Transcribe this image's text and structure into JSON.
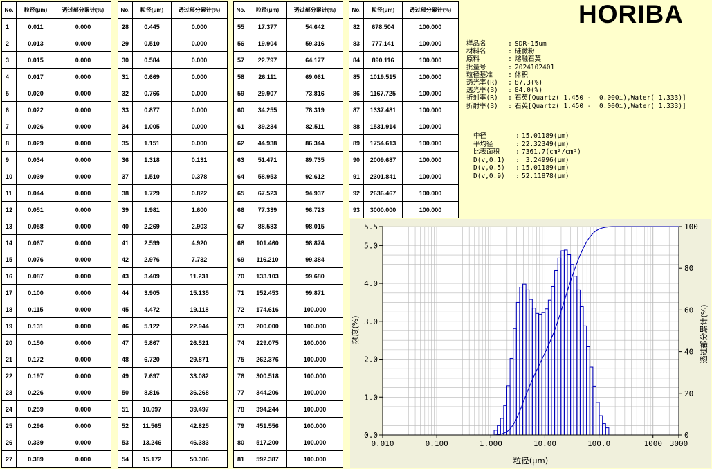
{
  "table": {
    "headers": [
      "No.",
      "粒径(μm)",
      "透过部分累计(%)"
    ],
    "columns": [
      {
        "rows": [
          [
            "1",
            "0.011",
            "0.000"
          ],
          [
            "2",
            "0.013",
            "0.000"
          ],
          [
            "3",
            "0.015",
            "0.000"
          ],
          [
            "4",
            "0.017",
            "0.000"
          ],
          [
            "5",
            "0.020",
            "0.000"
          ],
          [
            "6",
            "0.022",
            "0.000"
          ],
          [
            "7",
            "0.026",
            "0.000"
          ],
          [
            "8",
            "0.029",
            "0.000"
          ],
          [
            "9",
            "0.034",
            "0.000"
          ],
          [
            "10",
            "0.039",
            "0.000"
          ],
          [
            "11",
            "0.044",
            "0.000"
          ],
          [
            "12",
            "0.051",
            "0.000"
          ],
          [
            "13",
            "0.058",
            "0.000"
          ],
          [
            "14",
            "0.067",
            "0.000"
          ],
          [
            "15",
            "0.076",
            "0.000"
          ],
          [
            "16",
            "0.087",
            "0.000"
          ],
          [
            "17",
            "0.100",
            "0.000"
          ],
          [
            "18",
            "0.115",
            "0.000"
          ],
          [
            "19",
            "0.131",
            "0.000"
          ],
          [
            "20",
            "0.150",
            "0.000"
          ],
          [
            "21",
            "0.172",
            "0.000"
          ],
          [
            "22",
            "0.197",
            "0.000"
          ],
          [
            "23",
            "0.226",
            "0.000"
          ],
          [
            "24",
            "0.259",
            "0.000"
          ],
          [
            "25",
            "0.296",
            "0.000"
          ],
          [
            "26",
            "0.339",
            "0.000"
          ],
          [
            "27",
            "0.389",
            "0.000"
          ]
        ]
      },
      {
        "rows": [
          [
            "28",
            "0.445",
            "0.000"
          ],
          [
            "29",
            "0.510",
            "0.000"
          ],
          [
            "30",
            "0.584",
            "0.000"
          ],
          [
            "31",
            "0.669",
            "0.000"
          ],
          [
            "32",
            "0.766",
            "0.000"
          ],
          [
            "33",
            "0.877",
            "0.000"
          ],
          [
            "34",
            "1.005",
            "0.000"
          ],
          [
            "35",
            "1.151",
            "0.000"
          ],
          [
            "36",
            "1.318",
            "0.131"
          ],
          [
            "37",
            "1.510",
            "0.378"
          ],
          [
            "38",
            "1.729",
            "0.822"
          ],
          [
            "39",
            "1.981",
            "1.600"
          ],
          [
            "40",
            "2.269",
            "2.903"
          ],
          [
            "41",
            "2.599",
            "4.920"
          ],
          [
            "42",
            "2.976",
            "7.732"
          ],
          [
            "43",
            "3.409",
            "11.231"
          ],
          [
            "44",
            "3.905",
            "15.135"
          ],
          [
            "45",
            "4.472",
            "19.118"
          ],
          [
            "46",
            "5.122",
            "22.944"
          ],
          [
            "47",
            "5.867",
            "26.521"
          ],
          [
            "48",
            "6.720",
            "29.871"
          ],
          [
            "49",
            "7.697",
            "33.082"
          ],
          [
            "50",
            "8.816",
            "36.268"
          ],
          [
            "51",
            "10.097",
            "39.497"
          ],
          [
            "52",
            "11.565",
            "42.825"
          ],
          [
            "53",
            "13.246",
            "46.383"
          ],
          [
            "54",
            "15.172",
            "50.306"
          ]
        ]
      },
      {
        "rows": [
          [
            "55",
            "17.377",
            "54.642"
          ],
          [
            "56",
            "19.904",
            "59.316"
          ],
          [
            "57",
            "22.797",
            "64.177"
          ],
          [
            "58",
            "26.111",
            "69.061"
          ],
          [
            "59",
            "29.907",
            "73.816"
          ],
          [
            "60",
            "34.255",
            "78.319"
          ],
          [
            "61",
            "39.234",
            "82.511"
          ],
          [
            "62",
            "44.938",
            "86.344"
          ],
          [
            "63",
            "51.471",
            "89.735"
          ],
          [
            "64",
            "58.953",
            "92.612"
          ],
          [
            "65",
            "67.523",
            "94.937"
          ],
          [
            "66",
            "77.339",
            "96.723"
          ],
          [
            "67",
            "88.583",
            "98.015"
          ],
          [
            "68",
            "101.460",
            "98.874"
          ],
          [
            "69",
            "116.210",
            "99.384"
          ],
          [
            "70",
            "133.103",
            "99.680"
          ],
          [
            "71",
            "152.453",
            "99.871"
          ],
          [
            "72",
            "174.616",
            "100.000"
          ],
          [
            "73",
            "200.000",
            "100.000"
          ],
          [
            "74",
            "229.075",
            "100.000"
          ],
          [
            "75",
            "262.376",
            "100.000"
          ],
          [
            "76",
            "300.518",
            "100.000"
          ],
          [
            "77",
            "344.206",
            "100.000"
          ],
          [
            "78",
            "394.244",
            "100.000"
          ],
          [
            "79",
            "451.556",
            "100.000"
          ],
          [
            "80",
            "517.200",
            "100.000"
          ],
          [
            "81",
            "592.387",
            "100.000"
          ]
        ]
      },
      {
        "rows": [
          [
            "82",
            "678.504",
            "100.000"
          ],
          [
            "83",
            "777.141",
            "100.000"
          ],
          [
            "84",
            "890.116",
            "100.000"
          ],
          [
            "85",
            "1019.515",
            "100.000"
          ],
          [
            "86",
            "1167.725",
            "100.000"
          ],
          [
            "87",
            "1337.481",
            "100.000"
          ],
          [
            "88",
            "1531.914",
            "100.000"
          ],
          [
            "89",
            "1754.613",
            "100.000"
          ],
          [
            "90",
            "2009.687",
            "100.000"
          ],
          [
            "91",
            "2301.841",
            "100.000"
          ],
          [
            "92",
            "2636.467",
            "100.000"
          ],
          [
            "93",
            "3000.000",
            "100.000"
          ]
        ]
      }
    ]
  },
  "logo": "HORIBA",
  "info": [
    {
      "k": "样品名",
      "v": "SDR-15um"
    },
    {
      "k": "材料名",
      "v": "硅微粉"
    },
    {
      "k": "原料",
      "v": "熔融石英"
    },
    {
      "k": "批量号",
      "v": "2024102401"
    },
    {
      "k": "粒径基准",
      "v": "体积"
    },
    {
      "k": "透光率(R)",
      "v": "87.3(%)"
    },
    {
      "k": "透光率(B)",
      "v": "84.0(%)"
    },
    {
      "k": "折射率(R)",
      "v": "石英[Quartz( 1.450 -  0.000i),Water( 1.333)]"
    },
    {
      "k": "折射率(B)",
      "v": "石英[Quartz( 1.450 -  0.000i),Water( 1.333)]"
    }
  ],
  "stats": [
    {
      "k": "中径",
      "v": "15.01189(μm)"
    },
    {
      "k": "平均径",
      "v": "22.32349(μm)"
    },
    {
      "k": "比表面积",
      "v": "7361.7(cm²/cm³)"
    },
    {
      "k": "D(v,0.1)",
      "v": " 3.24996(μm)"
    },
    {
      "k": "D(v,0.5)",
      "v": "15.01189(μm)"
    },
    {
      "k": "D(v,0.9)",
      "v": "52.11878(μm)"
    }
  ],
  "colors": {
    "background": "#ffffcc",
    "plot": "#ffffff",
    "series": "#0000bb",
    "grid": "#b8b8b8",
    "panel": "#f0f0dc"
  },
  "chart_data": {
    "type": "bar",
    "xscale": "log",
    "xlim": [
      0.01,
      3000
    ],
    "xticks": [
      0.01,
      0.1,
      1,
      10,
      100,
      1000,
      3000
    ],
    "xtick_labels": [
      "0.010",
      "0.100",
      "1.000",
      "10.00",
      "100.0",
      "1000",
      "3000"
    ],
    "xlabel": "粒径(μm)",
    "ylabel_left": "频度(%)",
    "ylabel_right": "透过部分累计(%)",
    "ylim_left": [
      0,
      5.5
    ],
    "yticks_left": [
      0,
      1.0,
      2.0,
      3.0,
      4.0,
      5.0,
      5.5
    ],
    "ytick_labels_left": [
      "0.0",
      "1.0",
      "2.0",
      "3.0",
      "4.0",
      "5.0",
      "5.5"
    ],
    "ylim_right": [
      0,
      100
    ],
    "yticks_right": [
      0,
      20,
      40,
      60,
      80,
      100
    ],
    "ytick_labels_right": [
      "0",
      "20",
      "40",
      "60",
      "80",
      "100"
    ],
    "grid": true,
    "series": [
      {
        "type": "bar",
        "x": [
          1.318,
          1.51,
          1.729,
          1.981,
          2.269,
          2.599,
          2.976,
          3.409,
          3.905,
          4.472,
          5.122,
          5.867,
          6.72,
          7.697,
          8.816,
          10.097,
          11.565,
          13.246,
          15.172,
          17.377,
          19.904,
          22.797,
          26.111,
          29.907,
          34.255,
          39.234,
          44.938,
          51.471,
          58.953,
          67.523,
          77.339,
          88.583,
          101.46,
          116.21,
          133.103,
          152.453
        ],
        "values": [
          0.13,
          0.25,
          0.44,
          0.78,
          1.3,
          2.02,
          2.81,
          3.5,
          3.9,
          3.98,
          3.83,
          3.58,
          3.35,
          3.21,
          3.19,
          3.23,
          3.33,
          3.56,
          3.92,
          4.34,
          4.67,
          4.86,
          4.88,
          4.76,
          4.5,
          4.19,
          3.83,
          3.39,
          2.88,
          2.33,
          1.79,
          1.29,
          0.86,
          0.51,
          0.3,
          0.19
        ]
      },
      {
        "type": "line",
        "axis": "right",
        "x": [
          1.151,
          1.318,
          1.51,
          1.729,
          1.981,
          2.269,
          2.599,
          2.976,
          3.409,
          3.905,
          4.472,
          5.122,
          5.867,
          6.72,
          7.697,
          8.816,
          10.097,
          11.565,
          13.246,
          15.172,
          17.377,
          19.904,
          22.797,
          26.111,
          29.907,
          34.255,
          39.234,
          44.938,
          51.471,
          58.953,
          67.523,
          77.339,
          88.583,
          101.46,
          116.21,
          133.103,
          152.453,
          174.616,
          3000
        ],
        "values": [
          0.0,
          0.131,
          0.378,
          0.822,
          1.6,
          2.903,
          4.92,
          7.732,
          11.231,
          15.135,
          19.118,
          22.944,
          26.521,
          29.871,
          33.082,
          36.268,
          39.497,
          42.825,
          46.383,
          50.306,
          54.642,
          59.316,
          64.177,
          69.061,
          73.816,
          78.319,
          82.511,
          86.344,
          89.735,
          92.612,
          94.937,
          96.723,
          98.015,
          98.874,
          99.384,
          99.68,
          99.871,
          100.0,
          100.0
        ]
      }
    ]
  }
}
